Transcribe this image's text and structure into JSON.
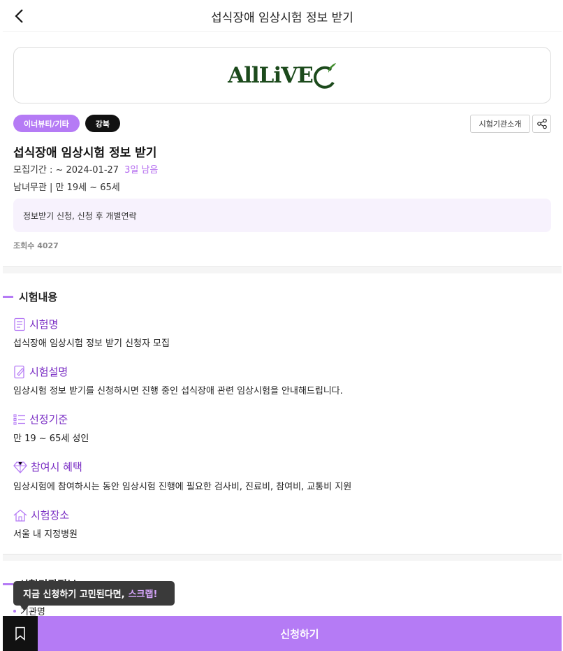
{
  "header": {
    "title": "섭식장애 임상시험 정보 받기"
  },
  "logo": {
    "text": "AllLiVE"
  },
  "tags": [
    "이너뷰티/기타",
    "강북"
  ],
  "actions": {
    "intro_label": "시험기관소개"
  },
  "trial": {
    "title": "섭식장애 임상시험 정보 받기",
    "period": "모집기간 : ~ 2024-01-27",
    "dday": "3일 남음",
    "condition": "남녀무관 | 만 19세 ~ 65세",
    "notice": "정보받기 신청, 신청 후 개별연락",
    "views": "조회수 4027"
  },
  "section": {
    "title": "시험내용",
    "items": [
      {
        "icon": "document-icon",
        "label": "시험명",
        "text": "섭식장애 임상시험 정보 받기 신청자 모집"
      },
      {
        "icon": "edit-document-icon",
        "label": "시험설명",
        "text": "임상시험 정보 받기를 신청하시면 진행 중인 섭식장애 관련 임상시험을 안내해드립니다."
      },
      {
        "icon": "list-icon",
        "label": "선정기준",
        "text": "만 19 ~ 65세 성인"
      },
      {
        "icon": "diamond-icon",
        "label": "참여시 혜택",
        "text": "임상시험에 참여하시는 동안 임상시험 진행에 필요한 검사비, 진료비, 참여비, 교통비 지원"
      },
      {
        "icon": "home-icon",
        "label": "시험장소",
        "text": "서울 내 지정병원"
      }
    ]
  },
  "section2": {
    "title": "시험기관정보",
    "first_item": "기관명"
  },
  "tooltip": {
    "text": "지금 신청하기 고민된다면,",
    "accent": "스크랩!"
  },
  "bottom": {
    "apply_label": "신청하기"
  },
  "colors": {
    "accent": "#b57bf5",
    "label": "#7a2ec4",
    "dark": "#111111"
  }
}
